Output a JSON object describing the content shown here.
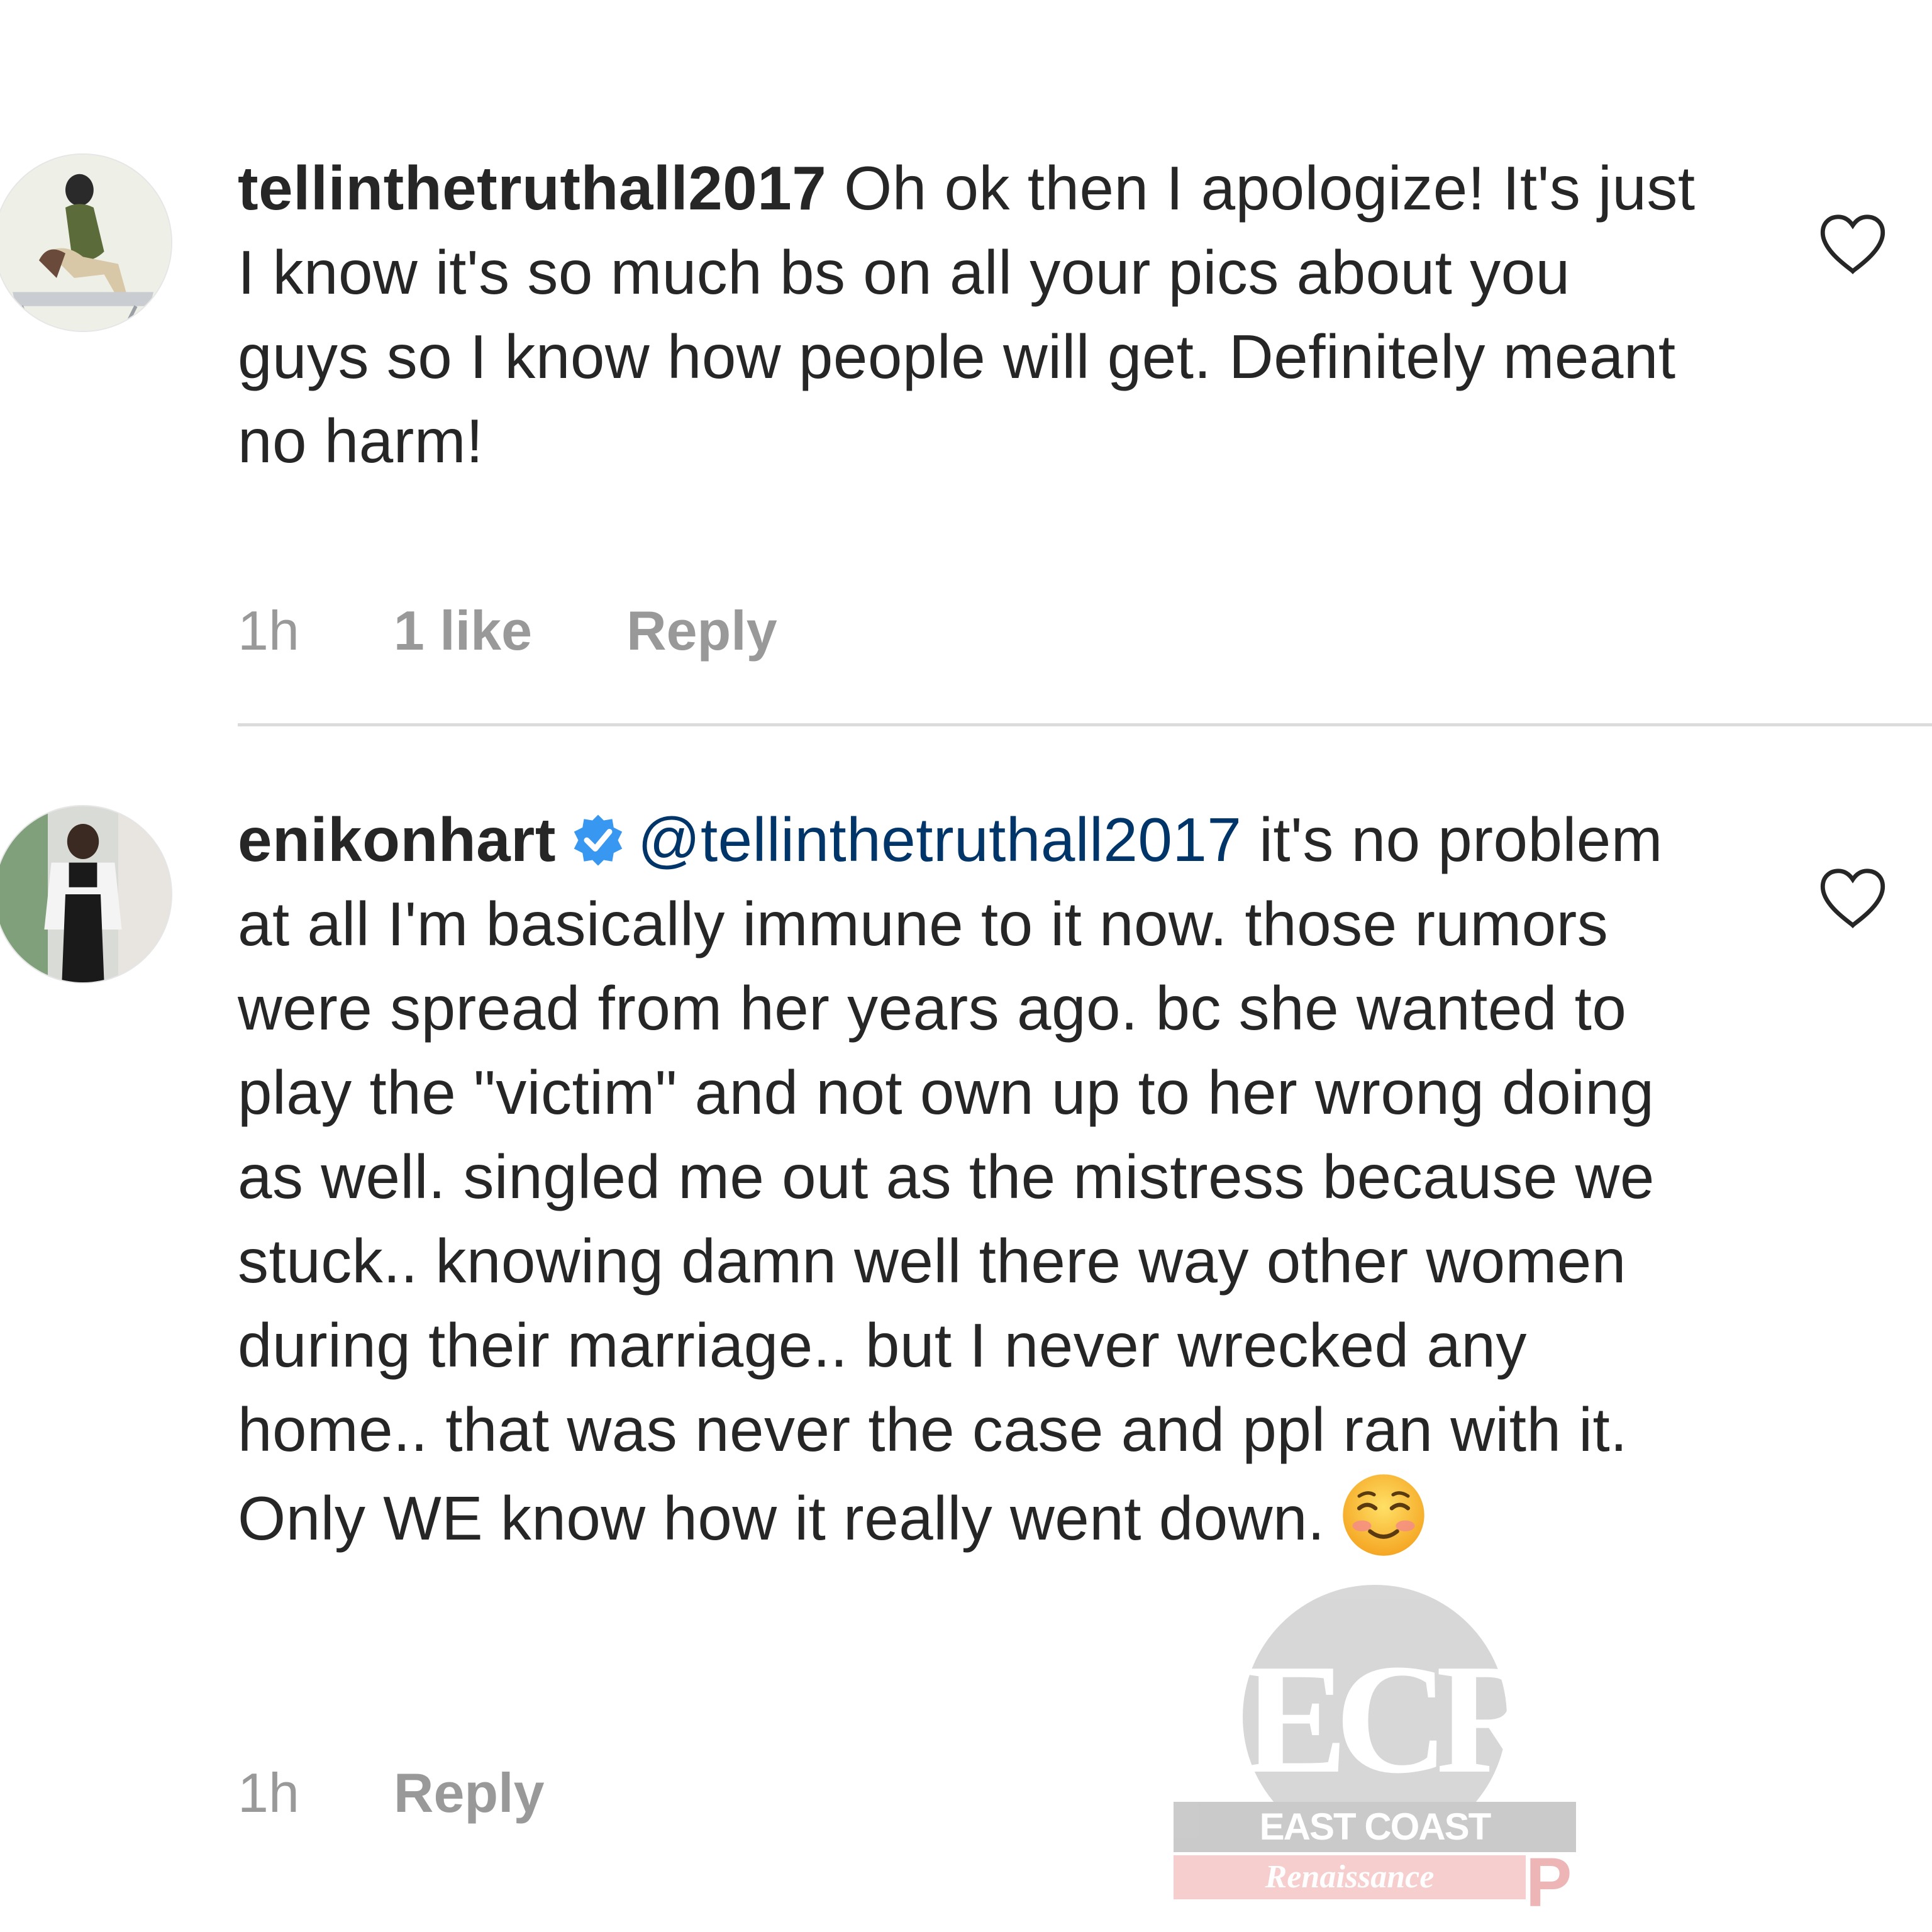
{
  "comments": [
    {
      "username": "tellinthetruthall2017",
      "verified": false,
      "mention": "",
      "text": "Oh ok then I apologize! It's just I know it's so much bs on all your pics about you guys so I know how people will get. Definitely meant no harm!",
      "time": "1h",
      "likes": "1 like",
      "reply_label": "Reply",
      "avatar_icon": "user-avatar-icon",
      "like_icon": "heart-outline-icon"
    },
    {
      "username": "enikonhart",
      "verified": true,
      "verified_icon": "verified-badge-icon",
      "mention": "@tellinthetruthall2017",
      "text": "it's no problem at all I'm basically immune to it now. those rumors were spread from her years ago. bc she wanted to play the \"victim\" and not own up to her wrong doing as well. singled me out as the mistress because we stuck.. knowing damn well there way other women during their marriage.. but I never wrecked any home.. that was never the case and ppl ran with it. Only WE know how it really went down.",
      "emoji": "smiling-face-with-smiling-eyes-icon",
      "time": "1h",
      "reply_label": "Reply",
      "avatar_icon": "user-avatar-icon",
      "like_icon": "heart-outline-icon"
    }
  ],
  "watermark": {
    "monogram": "ECR",
    "line1": "EAST COAST",
    "line2": "Renaissance",
    "corner": "P"
  },
  "colors": {
    "text": "#262626",
    "meta": "#999999",
    "mention": "#003569",
    "verified": "#3897f0",
    "divider": "#dbdbdb"
  }
}
